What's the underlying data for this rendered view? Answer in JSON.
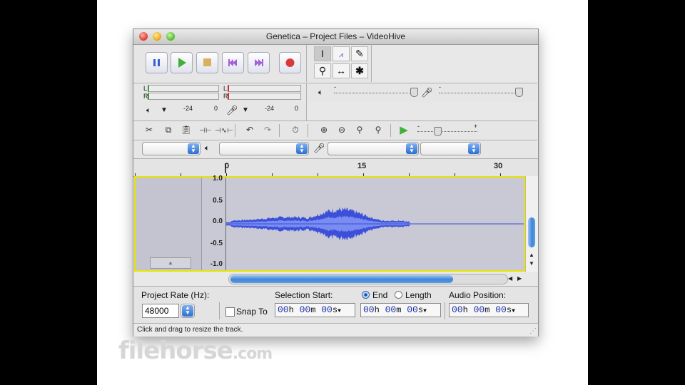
{
  "window": {
    "title": "Genetica – Project Files – VideoHive"
  },
  "meters": {
    "play_channels": [
      "L",
      "R"
    ],
    "play_scale": [
      "-24",
      "0"
    ],
    "rec_channels": [
      "L",
      "R"
    ],
    "rec_scale": [
      "-24",
      "0"
    ]
  },
  "mixer": {
    "volume_minus": "-",
    "gain_minus": "-"
  },
  "play_at_speed": {
    "minus": "-",
    "plus": "+"
  },
  "ruler": {
    "labels": [
      "0",
      "15",
      "30"
    ]
  },
  "track": {
    "vlabels": [
      "1.0",
      "0.5",
      "0.0",
      "-0.5",
      "-1.0"
    ]
  },
  "selection": {
    "rate_label": "Project Rate (Hz):",
    "rate_value": "48000",
    "snap_label": "Snap To",
    "start_label": "Selection Start:",
    "end_label": "End",
    "length_label": "Length",
    "audio_pos_label": "Audio Position:",
    "tc_parts": [
      "00",
      "h",
      "00",
      "m",
      "00",
      "s"
    ]
  },
  "status": {
    "text": "Click and drag to resize the track."
  },
  "watermark": {
    "text": "filehorse",
    "suffix": ".com"
  },
  "colors": {
    "waveform": "#3b4fd8",
    "waveform_rms": "#7a8cf2",
    "track_border": "#e8e400"
  }
}
